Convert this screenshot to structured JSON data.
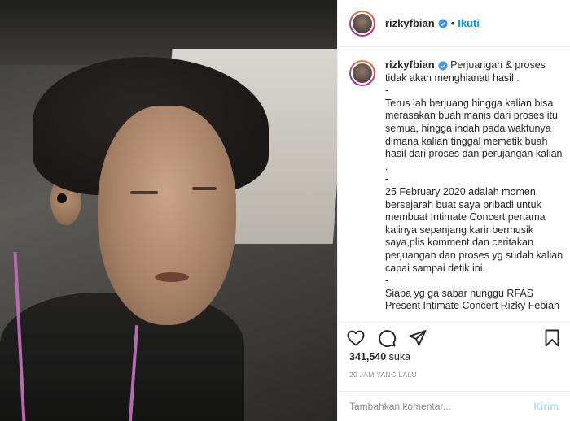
{
  "post": {
    "username": "rizkyfbian",
    "follow_label": "Ikuti",
    "separator": "•",
    "caption": "Perjuangan & proses tidak akan menghianati hasil .\n-\nTerus lah berjuang hingga kalian bisa merasakan buah manis dari proses itu semua, hingga indah pada waktunya dimana kalian tinggal memetik buah hasil dari proses dan perujangan kalian .\n-\n25 February 2020 adalah momen bersejarah buat saya pribadi,untuk membuat Intimate Concert pertama kalinya sepanjang karir bermusik saya,plis komment dan ceritakan perjuangan dan proses yg sudah kalian capai sampai detik ini.\n-\nSiapa yg ga sabar nunggu RFAS Present Intimate Concert Rizky Febian",
    "likes_count": "341,540",
    "likes_suffix": "suka",
    "timestamp": "20 JAM YANG LALU"
  },
  "comment": {
    "placeholder": "Tambahkan komentar...",
    "post_label": "Kirim"
  },
  "icons": {
    "like": "heart-icon",
    "comment": "comment-icon",
    "share": "share-icon",
    "save": "bookmark-icon",
    "verified": "verified-badge-icon"
  },
  "colors": {
    "follow": "#0095f6",
    "verified": "#3897f0",
    "post_disabled": "#b2dffc"
  }
}
